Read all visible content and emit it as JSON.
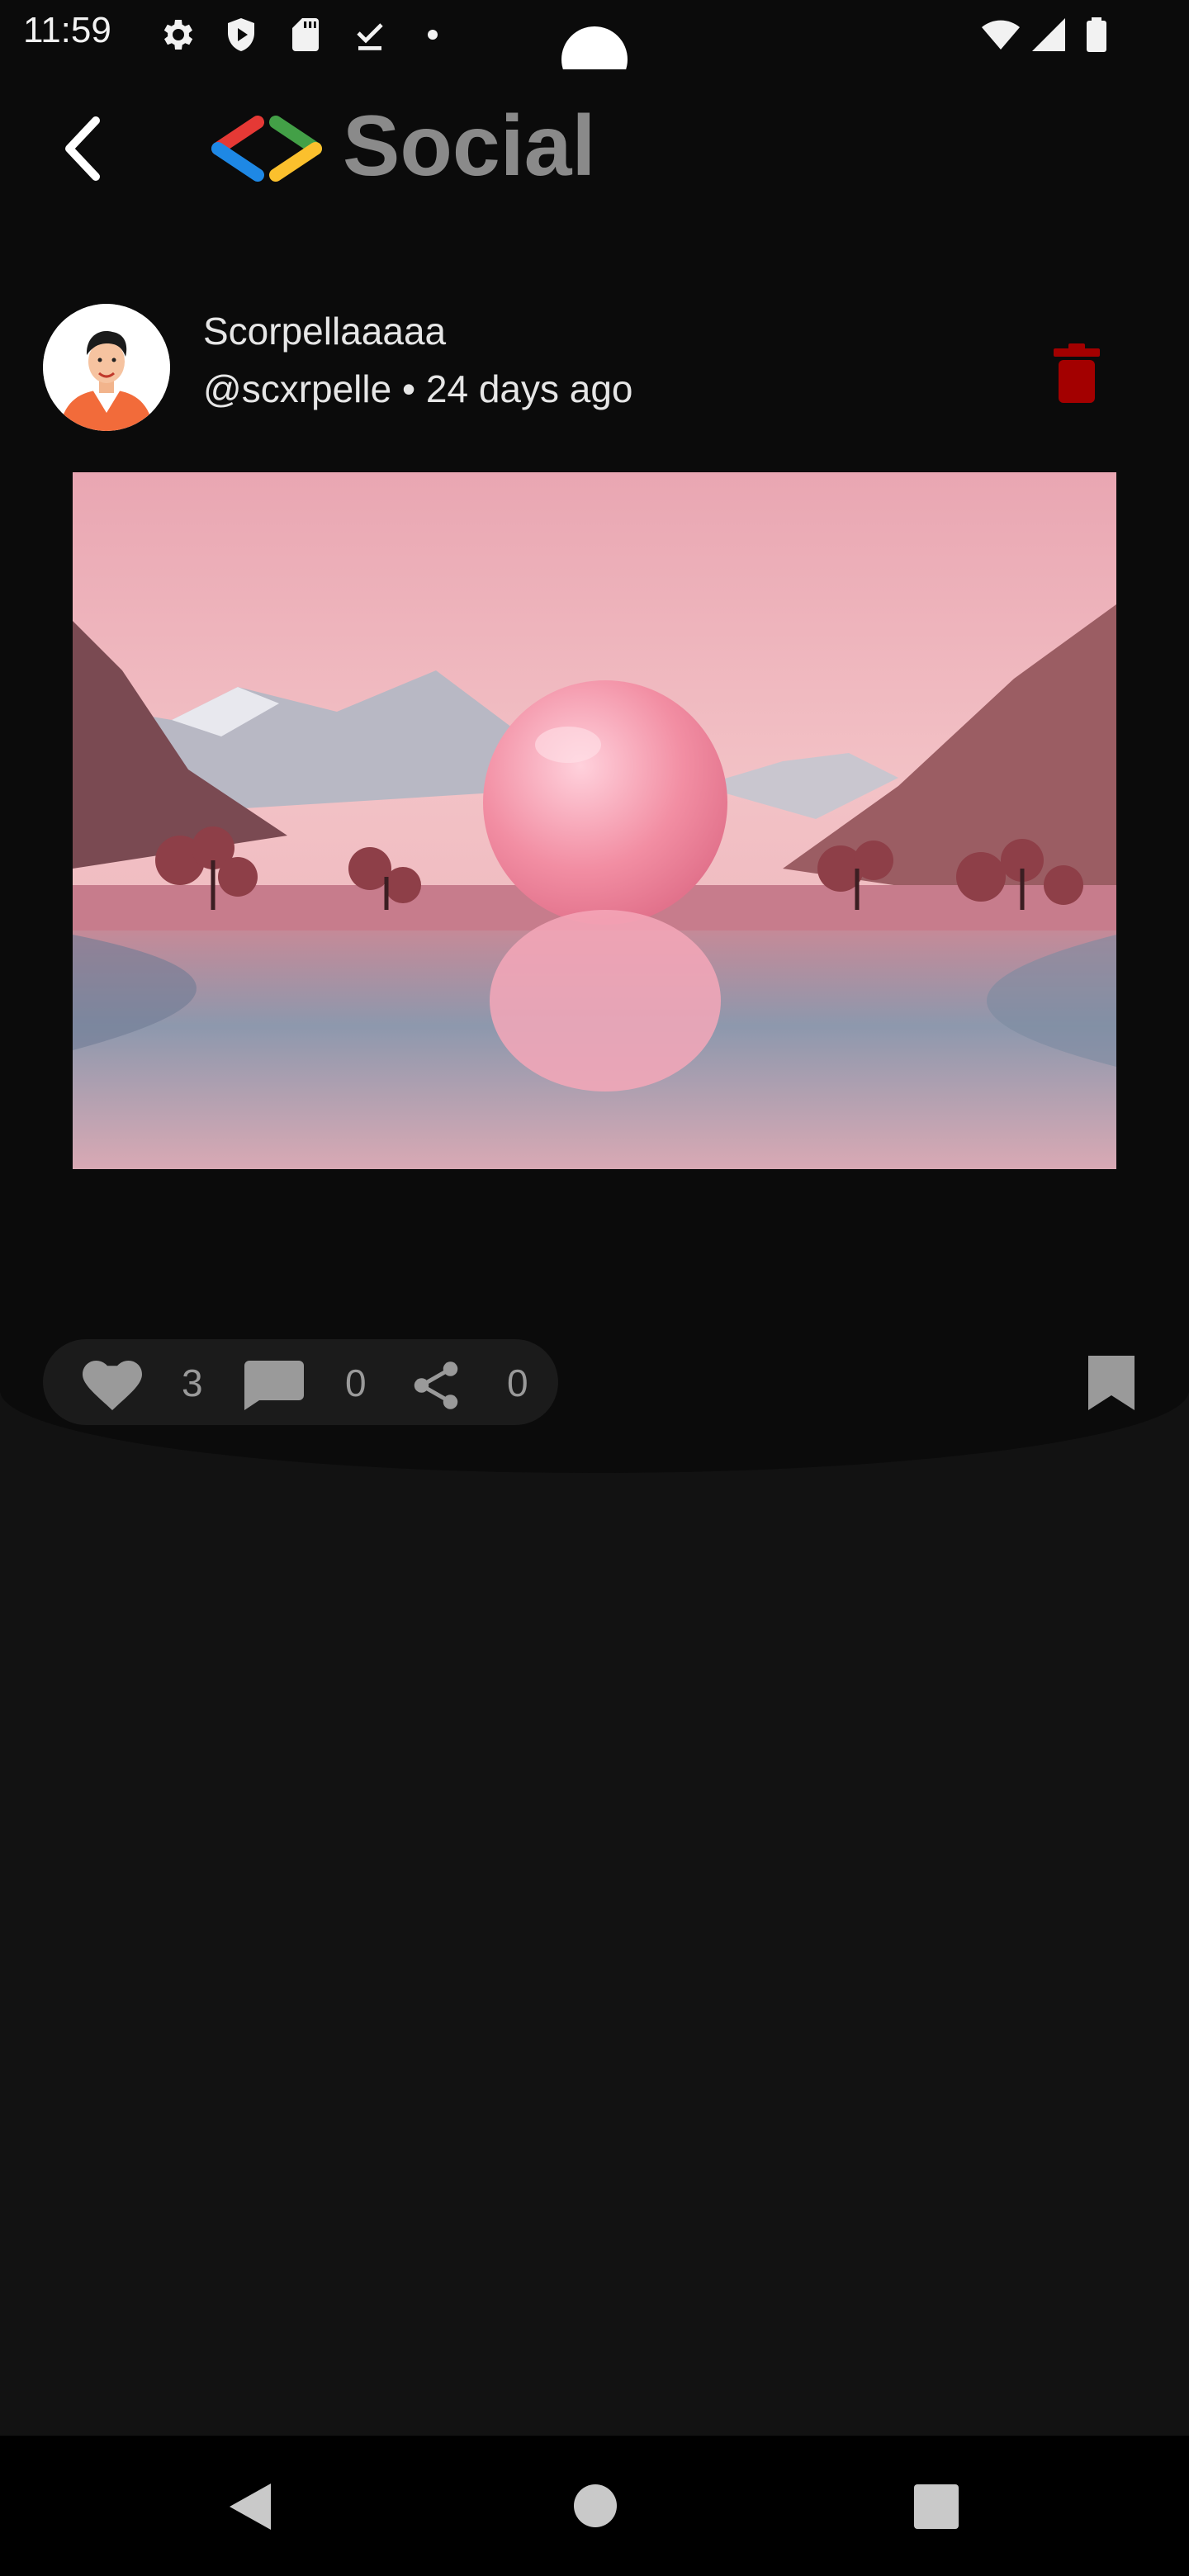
{
  "status_bar": {
    "time": "11:59",
    "icons": [
      "gear-icon",
      "shield-play-icon",
      "sd-card-icon",
      "download-done-icon",
      "dot-icon",
      "wifi-icon",
      "signal-icon",
      "battery-icon"
    ]
  },
  "header": {
    "back_icon": "chevron-left-icon",
    "logo": "code-brackets-logo",
    "title": "Social"
  },
  "post": {
    "author_name": "Scorpellaaaaa",
    "author_meta": "@scxrpelle • 24 days ago",
    "delete_icon": "trash-icon",
    "delete_color": "#a30000",
    "image_description_icon": "post-image",
    "likes": "3",
    "comments": "0",
    "shares": "0",
    "like_icon": "heart-icon",
    "comment_icon": "comment-icon",
    "share_icon": "share-icon",
    "bookmark_icon": "bookmark-icon"
  },
  "nav": {
    "back": "nav-back-icon",
    "home": "nav-home-icon",
    "recents": "nav-recents-icon"
  }
}
